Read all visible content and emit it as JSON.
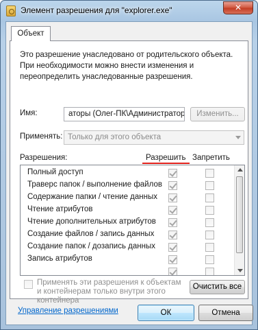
{
  "window": {
    "title": "Элемент разрешения для \"explorer.exe\"",
    "close_glyph": "✕"
  },
  "tab": {
    "label": "Объект"
  },
  "info_lines": [
    "Это разрешение унаследовано от родительского объекта.",
    "При необходимости можно внести изменения и",
    "переопределить унаследованные разрешения."
  ],
  "name": {
    "label": "Имя:",
    "value": "аторы (Олег-ПК\\Администраторы)",
    "change_button": "Изменить..."
  },
  "apply": {
    "label": "Применять:",
    "value": "Только для этого объекта"
  },
  "permissions": {
    "label": "Разрешения:",
    "allow_header": "Разрешить",
    "deny_header": "Запретить",
    "items": [
      {
        "name": "Полный доступ",
        "allow": true,
        "deny": false
      },
      {
        "name": "Траверс папок / выполнение файлов",
        "allow": true,
        "deny": false
      },
      {
        "name": "Содержание папки / чтение данных",
        "allow": true,
        "deny": false
      },
      {
        "name": "Чтение атрибутов",
        "allow": true,
        "deny": false
      },
      {
        "name": "Чтение дополнительных атрибутов",
        "allow": true,
        "deny": false
      },
      {
        "name": "Создание файлов / запись данных",
        "allow": true,
        "deny": false
      },
      {
        "name": "Создание папок / дозапись данных",
        "allow": true,
        "deny": false
      },
      {
        "name": "Запись атрибутов",
        "allow": true,
        "deny": false
      },
      {
        "name": "",
        "allow": true,
        "deny": false
      }
    ]
  },
  "apply_to_children": {
    "text": "Применять эти разрешения к объектам и контейнерам только внутри этого контейнера",
    "checked": false
  },
  "clear_all_button": "Очистить все",
  "manage_link": "Управление разрешениями",
  "footer": {
    "ok": "ОК",
    "cancel": "Отмена"
  },
  "colors": {
    "accent_underline": "#e0201a",
    "link": "#0066cc",
    "title_bar": "#a9c6e2"
  }
}
